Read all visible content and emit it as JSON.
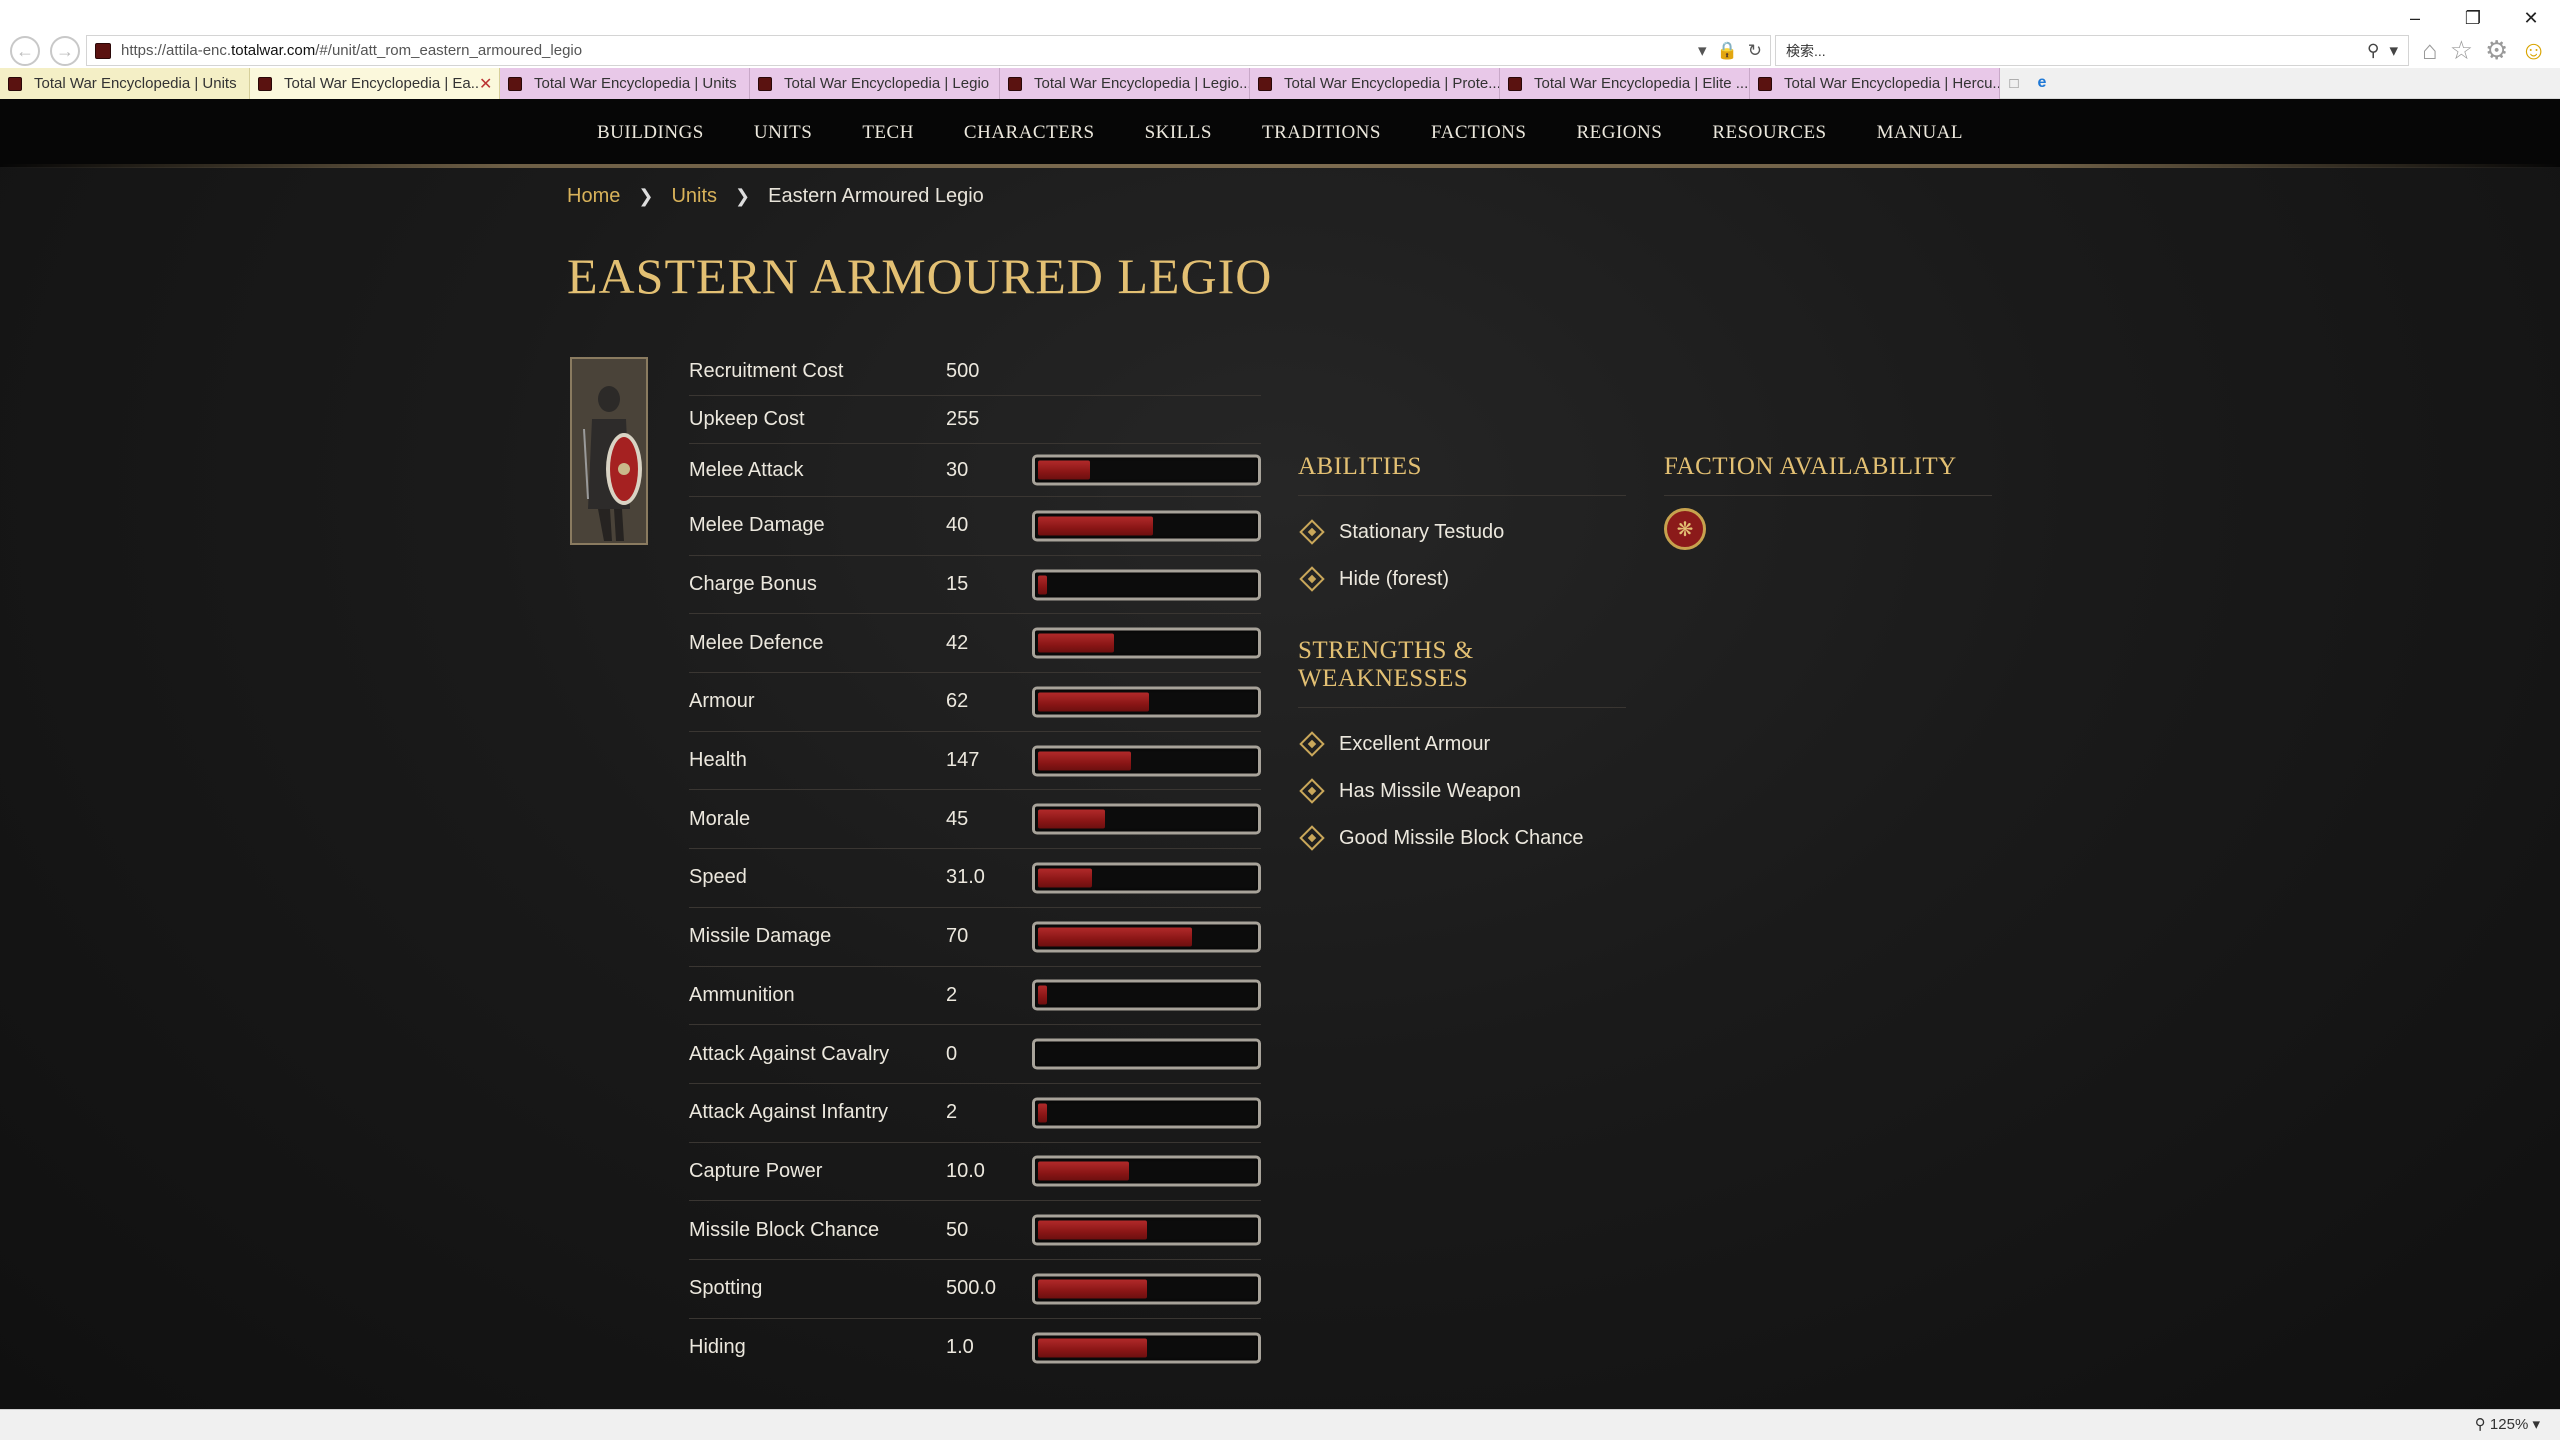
{
  "browser": {
    "url_prefix": "https://attila-enc.",
    "url_domain": "totalwar.com",
    "url_suffix": "/#/unit/att_rom_eastern_armoured_legio",
    "search_placeholder": "検索...",
    "zoom": "125%",
    "tabs": [
      {
        "label": "Total War Encyclopedia | Units"
      },
      {
        "label": "Total War Encyclopedia | Ea..."
      },
      {
        "label": "Total War Encyclopedia | Units"
      },
      {
        "label": "Total War Encyclopedia | Legio"
      },
      {
        "label": "Total War Encyclopedia | Legio..."
      },
      {
        "label": "Total War Encyclopedia | Prote..."
      },
      {
        "label": "Total War Encyclopedia | Elite ..."
      },
      {
        "label": "Total War Encyclopedia | Hercu..."
      }
    ]
  },
  "nav": {
    "items": [
      "BUILDINGS",
      "UNITS",
      "TECH",
      "CHARACTERS",
      "SKILLS",
      "TRADITIONS",
      "FACTIONS",
      "REGIONS",
      "RESOURCES",
      "MANUAL"
    ]
  },
  "breadcrumb": {
    "home": "Home",
    "units": "Units",
    "current": "Eastern Armoured Legio"
  },
  "unit": {
    "title": "EASTERN ARMOURED LEGIO",
    "costs": [
      {
        "label": "Recruitment Cost",
        "value": "500"
      },
      {
        "label": "Upkeep Cost",
        "value": "255"
      }
    ],
    "stats": [
      {
        "label": "Melee Attack",
        "value": "30",
        "fill": 0.24
      },
      {
        "label": "Melee Damage",
        "value": "40",
        "fill": 0.53
      },
      {
        "label": "Charge Bonus",
        "value": "15",
        "fill": 0.04
      },
      {
        "label": "Melee Defence",
        "value": "42",
        "fill": 0.35
      },
      {
        "label": "Armour",
        "value": "62",
        "fill": 0.51
      },
      {
        "label": "Health",
        "value": "147",
        "fill": 0.43
      },
      {
        "label": "Morale",
        "value": "45",
        "fill": 0.31
      },
      {
        "label": "Speed",
        "value": "31.0",
        "fill": 0.25
      },
      {
        "label": "Missile Damage",
        "value": "70",
        "fill": 0.71
      },
      {
        "label": "Ammunition",
        "value": "2",
        "fill": 0.04
      },
      {
        "label": "Attack Against Cavalry",
        "value": "0",
        "fill": 0.0
      },
      {
        "label": "Attack Against Infantry",
        "value": "2",
        "fill": 0.04
      },
      {
        "label": "Capture Power",
        "value": "10.0",
        "fill": 0.42
      },
      {
        "label": "Missile Block Chance",
        "value": "50",
        "fill": 0.5
      },
      {
        "label": "Spotting",
        "value": "500.0",
        "fill": 0.5
      },
      {
        "label": "Hiding",
        "value": "1.0",
        "fill": 0.5
      }
    ]
  },
  "abilities": {
    "title": "ABILITIES",
    "items": [
      "Stationary Testudo",
      "Hide (forest)"
    ]
  },
  "strengths": {
    "title": "STRENGTHS & WEAKNESSES",
    "items": [
      "Excellent Armour",
      "Has Missile Weapon",
      "Good Missile Block Chance"
    ]
  },
  "faction": {
    "title": "FACTION AVAILABILITY",
    "icon": "eagle-emblem-icon"
  },
  "colors": {
    "accent_gold": "#e3c073",
    "link_gold": "#d8b25a",
    "bar_red": "#9a1e1e"
  }
}
